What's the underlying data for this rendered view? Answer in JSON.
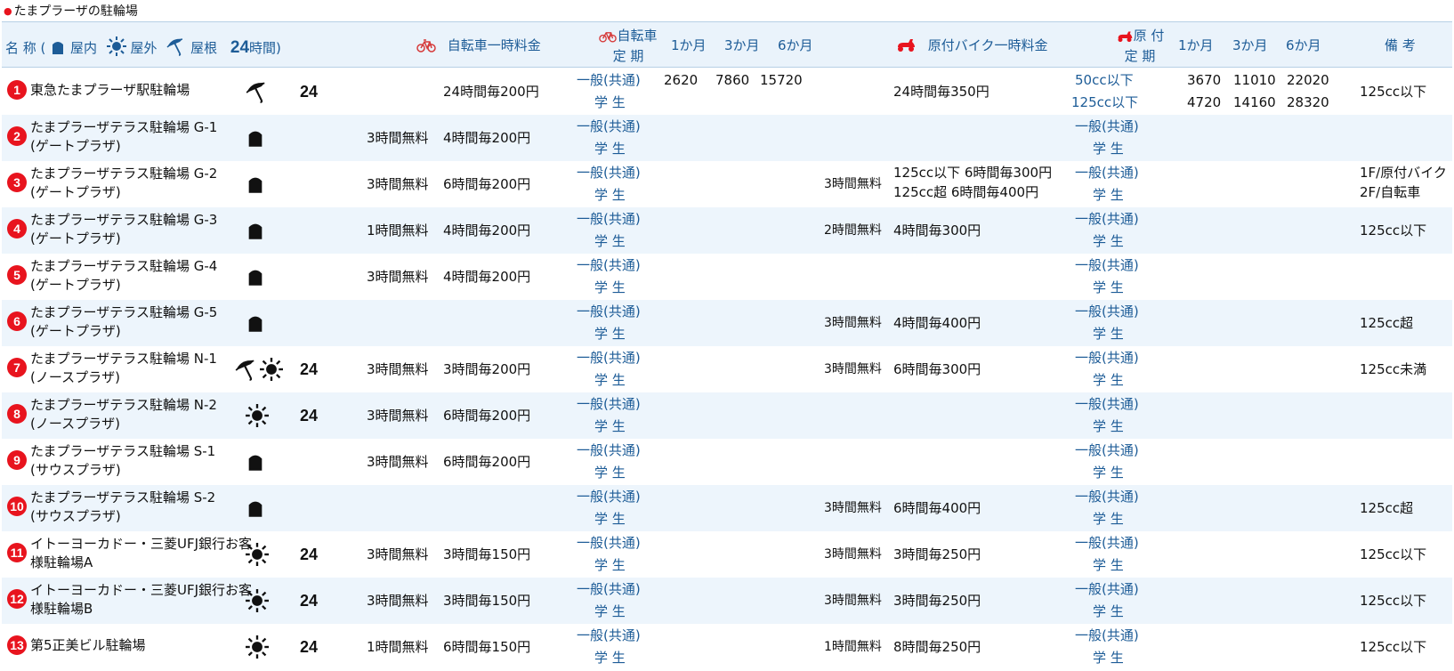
{
  "page_title": "たまプラーザの駐輪場",
  "header": {
    "name_label": "名 称 (",
    "indoor": "屋内",
    "outdoor": "屋外",
    "roof": "屋根",
    "h24": "24",
    "h24_suffix": "時間)",
    "bicycle_temp": "自転車一時料金",
    "bicycle_pass_1": "自転車",
    "bicycle_pass_2": "定 期",
    "b_1m": "1か月",
    "b_3m": "3か月",
    "b_6m": "6か月",
    "moped_temp": "原付バイク一時料金",
    "moped_pass_1": "原 付",
    "moped_pass_2": "定 期",
    "m_1m": "1か月",
    "m_3m": "3か月",
    "m_6m": "6か月",
    "remarks": "備 考"
  },
  "rows": [
    {
      "no": "1",
      "name1": "東急たまプラーザ駅駐輪場",
      "name2": "",
      "icons": [
        "umbrella"
      ],
      "h24": "24",
      "b_free": "",
      "b_rate": "24時間毎200円",
      "pass1": "一般(共通)",
      "pass2": "学 生",
      "b1": "2620",
      "b3": "7860",
      "b6": "15720",
      "m_free": "",
      "m_rate1": "24時間毎350円",
      "m_rate2": "",
      "mpass1": "50cc以下",
      "mpass2": "125cc以下",
      "m1a": "3670",
      "m3a": "11010",
      "m6a": "22020",
      "m1b": "4720",
      "m3b": "14160",
      "m6b": "28320",
      "remark1": "125cc以下",
      "remark2": ""
    },
    {
      "no": "2",
      "name1": "たまプラーザテラス駐輪場 G-1",
      "name2": "(ゲートプラザ)",
      "icons": [
        "indoor"
      ],
      "h24": "",
      "b_free": "3時間無料",
      "b_rate": "4時間毎200円",
      "pass1": "一般(共通)",
      "pass2": "学 生",
      "b1": "",
      "b3": "",
      "b6": "",
      "m_free": "",
      "m_rate1": "",
      "m_rate2": "",
      "mpass1": "一般(共通)",
      "mpass2": "学 生",
      "m1a": "",
      "m3a": "",
      "m6a": "",
      "m1b": "",
      "m3b": "",
      "m6b": "",
      "remark1": "",
      "remark2": ""
    },
    {
      "no": "3",
      "name1": "たまプラーザテラス駐輪場 G-2",
      "name2": "(ゲートプラザ)",
      "icons": [
        "indoor"
      ],
      "h24": "",
      "b_free": "3時間無料",
      "b_rate": "6時間毎200円",
      "pass1": "一般(共通)",
      "pass2": "学 生",
      "b1": "",
      "b3": "",
      "b6": "",
      "m_free": "3時間無料",
      "m_rate1": "125cc以下 6時間毎300円",
      "m_rate2": "125cc超 6時間毎400円",
      "mpass1": "一般(共通)",
      "mpass2": "学 生",
      "m1a": "",
      "m3a": "",
      "m6a": "",
      "m1b": "",
      "m3b": "",
      "m6b": "",
      "remark1": "1F/原付バイク",
      "remark2": "2F/自転車"
    },
    {
      "no": "4",
      "name1": "たまプラーザテラス駐輪場 G-3",
      "name2": "(ゲートプラザ)",
      "icons": [
        "indoor"
      ],
      "h24": "",
      "b_free": "1時間無料",
      "b_rate": "4時間毎200円",
      "pass1": "一般(共通)",
      "pass2": "学 生",
      "b1": "",
      "b3": "",
      "b6": "",
      "m_free": "2時間無料",
      "m_rate1": "4時間毎300円",
      "m_rate2": "",
      "mpass1": "一般(共通)",
      "mpass2": "学 生",
      "m1a": "",
      "m3a": "",
      "m6a": "",
      "m1b": "",
      "m3b": "",
      "m6b": "",
      "remark1": "125cc以下",
      "remark2": ""
    },
    {
      "no": "5",
      "name1": "たまプラーザテラス駐輪場 G-4",
      "name2": "(ゲートプラザ)",
      "icons": [
        "indoor"
      ],
      "h24": "",
      "b_free": "3時間無料",
      "b_rate": "4時間毎200円",
      "pass1": "一般(共通)",
      "pass2": "学 生",
      "b1": "",
      "b3": "",
      "b6": "",
      "m_free": "",
      "m_rate1": "",
      "m_rate2": "",
      "mpass1": "一般(共通)",
      "mpass2": "学 生",
      "m1a": "",
      "m3a": "",
      "m6a": "",
      "m1b": "",
      "m3b": "",
      "m6b": "",
      "remark1": "",
      "remark2": ""
    },
    {
      "no": "6",
      "name1": "たまプラーザテラス駐輪場 G-5",
      "name2": "(ゲートプラザ)",
      "icons": [
        "indoor"
      ],
      "h24": "",
      "b_free": "",
      "b_rate": "",
      "pass1": "一般(共通)",
      "pass2": "学 生",
      "b1": "",
      "b3": "",
      "b6": "",
      "m_free": "3時間無料",
      "m_rate1": "4時間毎400円",
      "m_rate2": "",
      "mpass1": "一般(共通)",
      "mpass2": "学 生",
      "m1a": "",
      "m3a": "",
      "m6a": "",
      "m1b": "",
      "m3b": "",
      "m6b": "",
      "remark1": "125cc超",
      "remark2": ""
    },
    {
      "no": "7",
      "name1": "たまプラーザテラス駐輪場 N-1",
      "name2": "(ノースプラザ)",
      "icons": [
        "umbrella",
        "sun"
      ],
      "h24": "24",
      "b_free": "3時間無料",
      "b_rate": "3時間毎200円",
      "pass1": "一般(共通)",
      "pass2": "学 生",
      "b1": "",
      "b3": "",
      "b6": "",
      "m_free": "3時間無料",
      "m_rate1": "6時間毎300円",
      "m_rate2": "",
      "mpass1": "一般(共通)",
      "mpass2": "学 生",
      "m1a": "",
      "m3a": "",
      "m6a": "",
      "m1b": "",
      "m3b": "",
      "m6b": "",
      "remark1": "125cc未満",
      "remark2": ""
    },
    {
      "no": "8",
      "name1": "たまプラーザテラス駐輪場 N-2",
      "name2": "(ノースプラザ)",
      "icons": [
        "sun"
      ],
      "h24": "24",
      "b_free": "3時間無料",
      "b_rate": "6時間毎200円",
      "pass1": "一般(共通)",
      "pass2": "学 生",
      "b1": "",
      "b3": "",
      "b6": "",
      "m_free": "",
      "m_rate1": "",
      "m_rate2": "",
      "mpass1": "一般(共通)",
      "mpass2": "学 生",
      "m1a": "",
      "m3a": "",
      "m6a": "",
      "m1b": "",
      "m3b": "",
      "m6b": "",
      "remark1": "",
      "remark2": ""
    },
    {
      "no": "9",
      "name1": "たまプラーザテラス駐輪場 S-1",
      "name2": "(サウスプラザ)",
      "icons": [
        "indoor"
      ],
      "h24": "",
      "b_free": "3時間無料",
      "b_rate": "6時間毎200円",
      "pass1": "一般(共通)",
      "pass2": "学 生",
      "b1": "",
      "b3": "",
      "b6": "",
      "m_free": "",
      "m_rate1": "",
      "m_rate2": "",
      "mpass1": "一般(共通)",
      "mpass2": "学 生",
      "m1a": "",
      "m3a": "",
      "m6a": "",
      "m1b": "",
      "m3b": "",
      "m6b": "",
      "remark1": "",
      "remark2": ""
    },
    {
      "no": "10",
      "name1": "たまプラーザテラス駐輪場 S-2",
      "name2": "(サウスプラザ)",
      "icons": [
        "indoor"
      ],
      "h24": "",
      "b_free": "",
      "b_rate": "",
      "pass1": "一般(共通)",
      "pass2": "学 生",
      "b1": "",
      "b3": "",
      "b6": "",
      "m_free": "3時間無料",
      "m_rate1": "6時間毎400円",
      "m_rate2": "",
      "mpass1": "一般(共通)",
      "mpass2": "学 生",
      "m1a": "",
      "m3a": "",
      "m6a": "",
      "m1b": "",
      "m3b": "",
      "m6b": "",
      "remark1": "125cc超",
      "remark2": ""
    },
    {
      "no": "11",
      "name1": "イトーヨーカドー・三菱UFJ銀行お客",
      "name2": "様駐輪場A",
      "icons": [
        "sun"
      ],
      "h24": "24",
      "b_free": "3時間無料",
      "b_rate": "3時間毎150円",
      "pass1": "一般(共通)",
      "pass2": "学 生",
      "b1": "",
      "b3": "",
      "b6": "",
      "m_free": "3時間無料",
      "m_rate1": "3時間毎250円",
      "m_rate2": "",
      "mpass1": "一般(共通)",
      "mpass2": "学 生",
      "m1a": "",
      "m3a": "",
      "m6a": "",
      "m1b": "",
      "m3b": "",
      "m6b": "",
      "remark1": "125cc以下",
      "remark2": ""
    },
    {
      "no": "12",
      "name1": "イトーヨーカドー・三菱UFJ銀行お客",
      "name2": "様駐輪場B",
      "icons": [
        "sun"
      ],
      "h24": "24",
      "b_free": "3時間無料",
      "b_rate": "3時間毎150円",
      "pass1": "一般(共通)",
      "pass2": "学 生",
      "b1": "",
      "b3": "",
      "b6": "",
      "m_free": "3時間無料",
      "m_rate1": "3時間毎250円",
      "m_rate2": "",
      "mpass1": "一般(共通)",
      "mpass2": "学 生",
      "m1a": "",
      "m3a": "",
      "m6a": "",
      "m1b": "",
      "m3b": "",
      "m6b": "",
      "remark1": "125cc以下",
      "remark2": ""
    },
    {
      "no": "13",
      "name1": "第5正美ビル駐輪場",
      "name2": "",
      "icons": [
        "sun"
      ],
      "h24": "24",
      "b_free": "1時間無料",
      "b_rate": "6時間毎150円",
      "pass1": "一般(共通)",
      "pass2": "学 生",
      "b1": "",
      "b3": "",
      "b6": "",
      "m_free": "1時間無料",
      "m_rate1": "8時間毎250円",
      "m_rate2": "",
      "mpass1": "一般(共通)",
      "mpass2": "学 生",
      "m1a": "",
      "m3a": "",
      "m6a": "",
      "m1b": "",
      "m3b": "",
      "m6b": "",
      "remark1": "125cc以下",
      "remark2": ""
    }
  ]
}
